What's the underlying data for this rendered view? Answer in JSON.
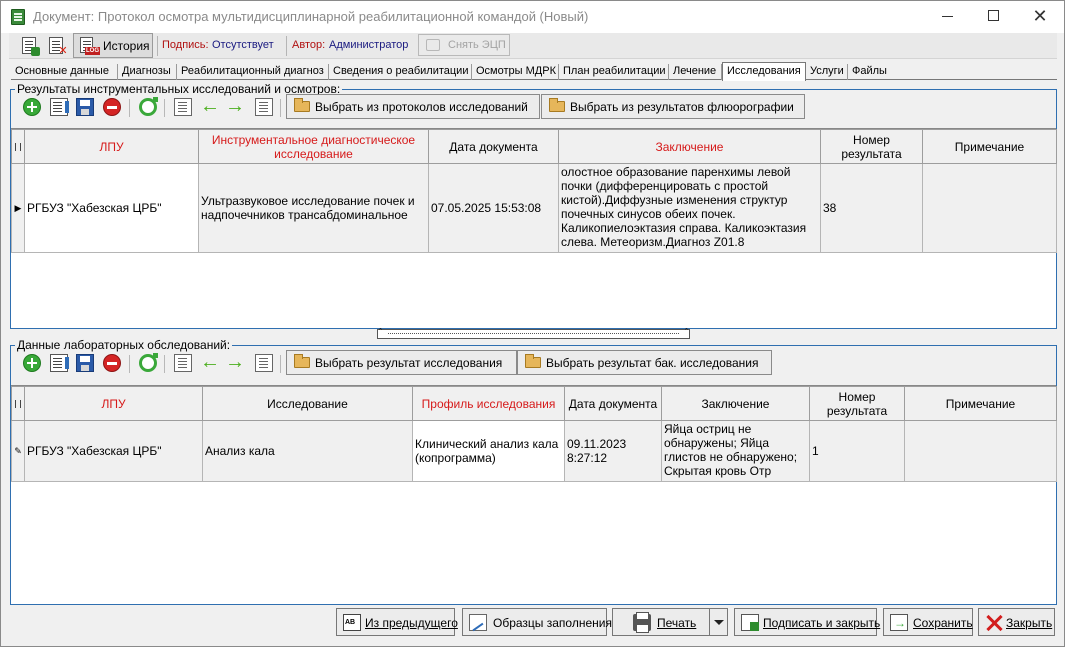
{
  "window": {
    "title": "Документ: Протокол осмотра мультидисциплинарной реабилитационной командой (Новый)",
    "minimize_glyph": "—",
    "close_glyph": "✕"
  },
  "toolbar": {
    "history_label": "История",
    "history_badge": "LOG",
    "signature_label": "Подпись:",
    "signature_value": "Отсутствует",
    "author_label": "Автор:",
    "author_value": "Администратор",
    "remove_ecp_label": "Снять ЭЦП"
  },
  "tabs": [
    {
      "label": "Основные данные"
    },
    {
      "label": "Диагнозы"
    },
    {
      "label": "Реабилитационный диагноз"
    },
    {
      "label": "Сведения о реабилитации"
    },
    {
      "label": "Осмотры МДРК"
    },
    {
      "label": "План реабилитации"
    },
    {
      "label": "Лечение"
    },
    {
      "label": "Исследования",
      "active": true
    },
    {
      "label": "Услуги"
    },
    {
      "label": "Файлы"
    }
  ],
  "instrumental": {
    "group_title": "Результаты инструментальных исследований и осмотров:",
    "btn_from_protocols": "Выбрать из протоколов исследований",
    "btn_from_fluoro": "Выбрать из результатов флюорографии",
    "columns": [
      "ЛПУ",
      "Инструментальное диагностическое исследование",
      "Дата документа",
      "Заключение",
      "Номер результата",
      "Примечание"
    ],
    "rows": [
      {
        "lpu": "РГБУЗ \"Хабезская ЦРБ\"",
        "study": "Ультразвуковое исследование почек и надпочечников трансабдоминальное",
        "date": "07.05.2025 15:53:08",
        "conclusion": "олостное образование паренхимы левой почки (дифференцировать с простой кистой).Диффузные изменения структур почечных синусов обеих почек. Каликопиелоэктазия справа.  Каликоэктазия слева. Метеоризм.Диагноз Z01.8",
        "result_no": "38",
        "note": ""
      }
    ]
  },
  "laboratory": {
    "group_title": "Данные лабораторных обследований:",
    "btn_select_result": "Выбрать результат исследования",
    "btn_select_bak": "Выбрать результат бак. исследования",
    "columns": [
      "ЛПУ",
      "Исследование",
      "Профиль исследования",
      "Дата документа",
      "Заключение",
      "Номер результата",
      "Примечание"
    ],
    "rows": [
      {
        "lpu": "РГБУЗ \"Хабезская ЦРБ\"",
        "study": "Анализ кала",
        "profile": "Клинический анализ кала (копрограмма)",
        "date": "09.11.2023 8:27:12",
        "conclusion": "Яйца остриц не обнаружены; Яйца глистов не обнаружено; Скрытая кровь Отр",
        "result_no": "1",
        "note": ""
      }
    ]
  },
  "footer": {
    "from_previous": "Из предыдущего",
    "samples": "Образцы заполнения",
    "print": "Печать",
    "sign_close": "Подписать и закрыть",
    "save": "Сохранить",
    "close": "Закрыть"
  }
}
